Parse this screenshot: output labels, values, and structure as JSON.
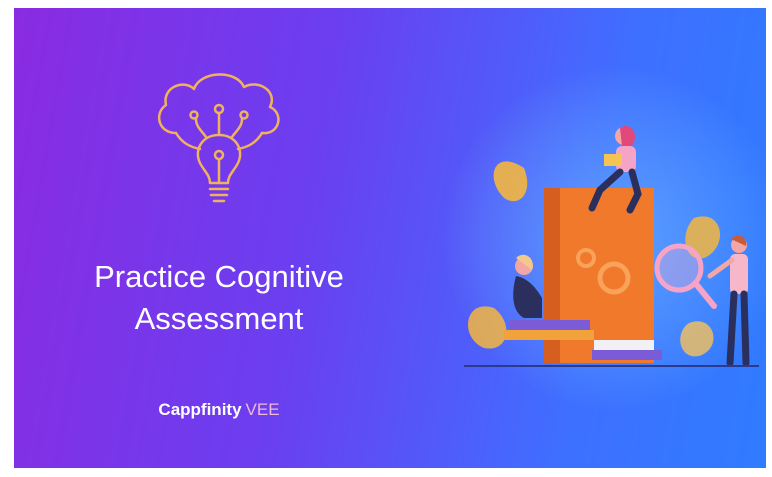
{
  "banner": {
    "title_line1": "Practice Cognitive",
    "title_line2": "Assessment",
    "brand_name": "Cappfinity",
    "brand_suffix": "VEE"
  },
  "colors": {
    "gradient_start": "#8a2be2",
    "gradient_end": "#2f7cff",
    "icon_color": "#f0b25c",
    "brand_suffix": "#f2b8d4"
  },
  "icons": [
    "brain-bulb-icon"
  ]
}
